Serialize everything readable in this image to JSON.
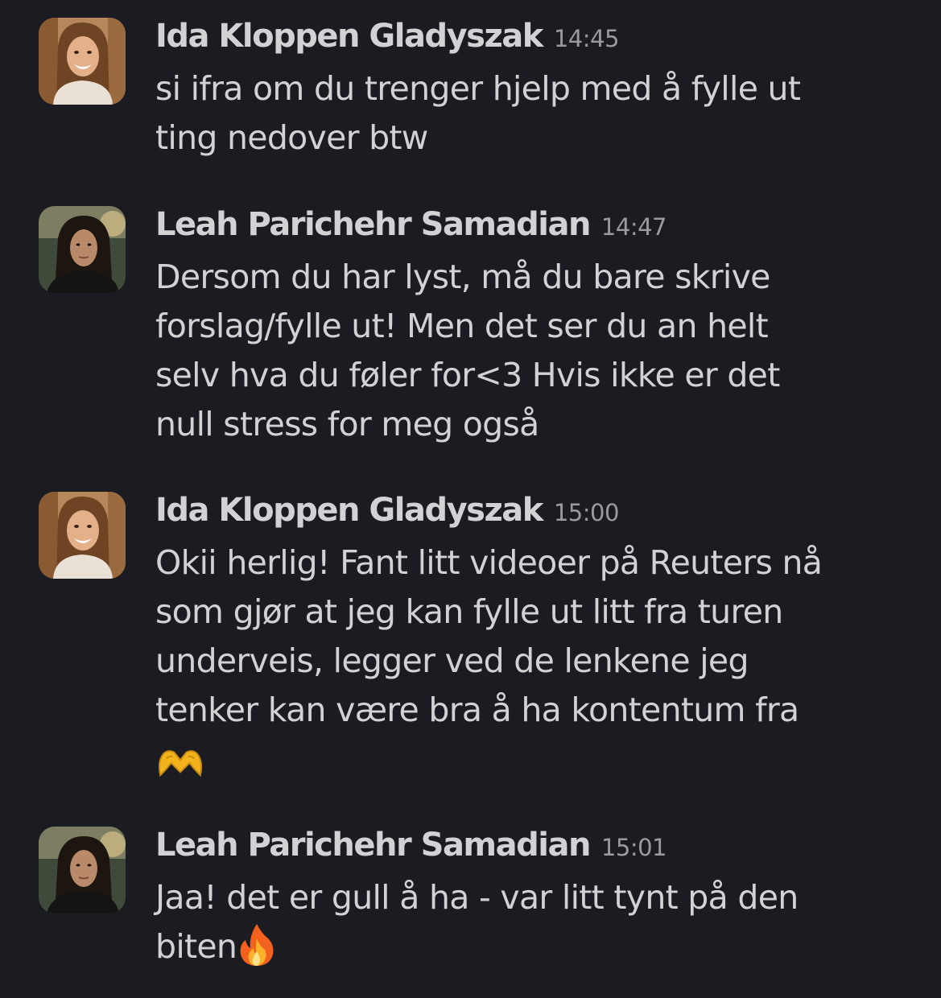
{
  "messages": [
    {
      "sender": "Ida Kloppen Gladyszak",
      "time": "14:45",
      "text": "si ifra om du trenger hjelp med å fylle ut\nting nedover btw",
      "avatar_icon": "ida-avatar"
    },
    {
      "sender": "Leah Parichehr Samadian",
      "time": "14:47",
      "text": "Dersom du har lyst, må du bare skrive\nforslag/fylle ut! Men det ser du an helt\nselv hva du føler for<3 Hvis ikke er det\nnull stress for meg også",
      "avatar_icon": "leah-avatar"
    },
    {
      "sender": "Ida Kloppen Gladyszak",
      "time": "15:00",
      "text": "Okii herlig! Fant litt videoer på Reuters nå\nsom gjør at jeg kan fylle ut litt fra turen\nunderveis, legger ved de lenkene jeg\ntenker kan være bra å ha kontentum fra",
      "emoji": "heart-hands-emoji",
      "avatar_icon": "ida-avatar"
    },
    {
      "sender": "Leah Parichehr Samadian",
      "time": "15:01",
      "text": "Jaa! det er gull å ha - var litt tynt på den\nbiten",
      "emoji": "fire-emoji",
      "avatar_icon": "leah-avatar"
    }
  ]
}
